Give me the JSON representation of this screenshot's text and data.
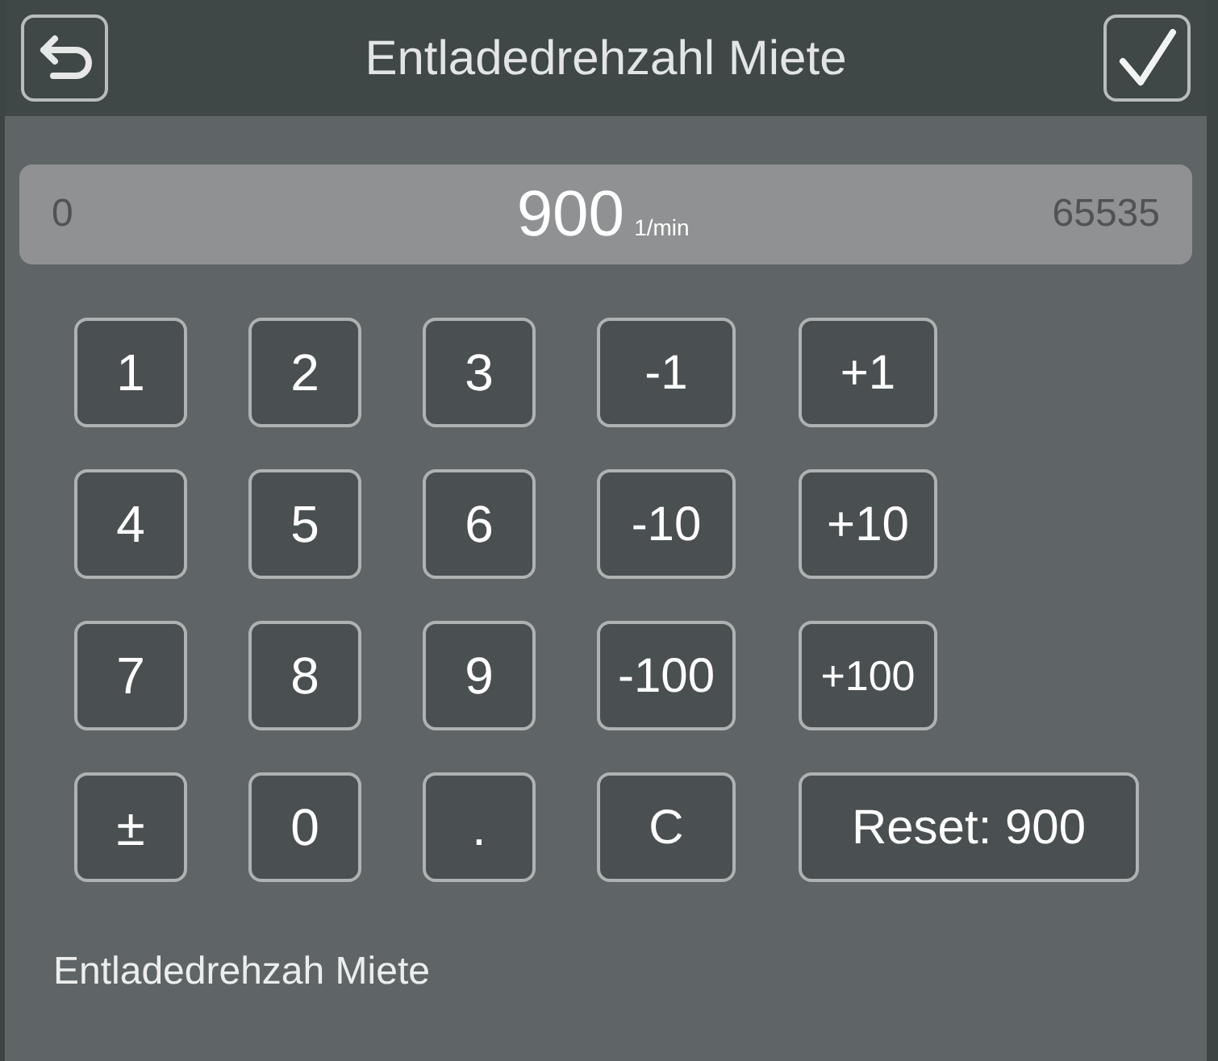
{
  "header": {
    "title": "Entladedrehzahl Miete"
  },
  "display": {
    "min": "0",
    "value": "900",
    "unit": "1/min",
    "max": "65535"
  },
  "keypad": [
    {
      "digits": [
        "1",
        "2",
        "3"
      ],
      "steps": [
        "-1",
        "+1"
      ]
    },
    {
      "digits": [
        "4",
        "5",
        "6"
      ],
      "steps": [
        "-10",
        "+10"
      ]
    },
    {
      "digits": [
        "7",
        "8",
        "9"
      ],
      "steps": [
        "-100",
        "+100"
      ]
    },
    {
      "digits": [
        "±",
        "0",
        "."
      ],
      "steps": [
        "C",
        "Reset: 900"
      ]
    }
  ],
  "footer": {
    "label": "Entladedrehzah Miete"
  }
}
